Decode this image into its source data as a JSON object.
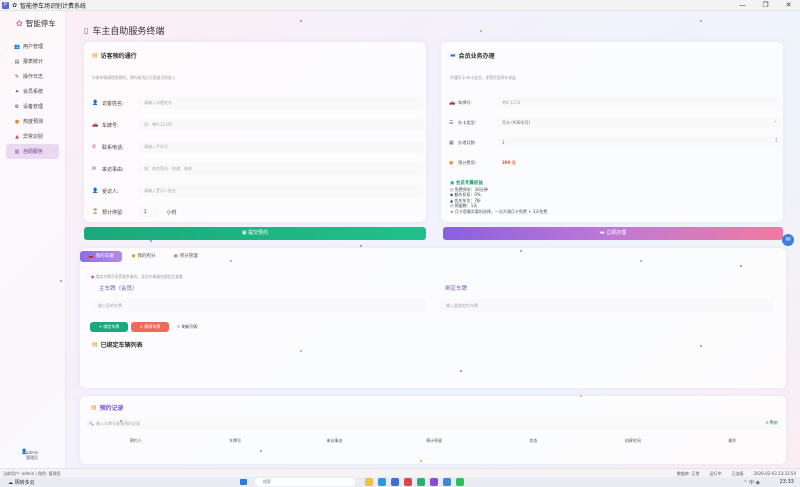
{
  "window": {
    "title": "智能停车场识别计费系统",
    "controls": [
      "—",
      "❐",
      "✕"
    ]
  },
  "sidebar": {
    "brand": "智能停车",
    "items": [
      {
        "label": "用户管理",
        "icon": "users-icon"
      },
      {
        "label": "报表统计",
        "icon": "chart-icon"
      },
      {
        "label": "操作日志",
        "icon": "log-icon"
      },
      {
        "label": "会员系统",
        "icon": "member-icon"
      },
      {
        "label": "设备管理",
        "icon": "device-icon"
      },
      {
        "label": "热度预测",
        "icon": "fire-icon"
      },
      {
        "label": "异常识别",
        "icon": "warning-icon"
      },
      {
        "label": "自助服务",
        "icon": "self-service-icon",
        "active": true
      }
    ],
    "user": {
      "name": "admin",
      "role": "管理员"
    }
  },
  "page": {
    "title": "车主自助服务终端"
  },
  "visitor": {
    "title": "访客预约通行",
    "subtitle": "外来车辆请提前预约，预约成功后可直接识别进入",
    "fields": [
      {
        "label": "访客姓名:",
        "placeholder": "请输入访客姓名"
      },
      {
        "label": "车牌号:",
        "placeholder": "如：粤A·12345"
      },
      {
        "label": "联系电话:",
        "placeholder": "请输入手机号"
      },
      {
        "label": "来访事由:",
        "placeholder": "如：商务拜访、快递、装修"
      },
      {
        "label": "受访人:",
        "placeholder": "请输入受访人姓名"
      }
    ],
    "duration": {
      "label": "预计停留:",
      "value": "2",
      "unit": "小时"
    },
    "submit": "提交预约"
  },
  "member": {
    "title": "会员业务办理",
    "subtitle": "开通月卡/年卡会员，享受优惠停车权益",
    "fields": [
      {
        "label": "车牌号:",
        "placeholder": "粤B·1234"
      },
      {
        "label": "办卡类型:",
        "value": "月卡 (¥300/月)"
      },
      {
        "label": "办理月数:",
        "value": "1"
      },
      {
        "label": "预计费用:",
        "value": "300 元"
      }
    ],
    "benefits_title": "会员专属权益",
    "benefits": [
      "免费停车：30分钟",
      "额外折扣：0%",
      "优先车位：7折",
      "预留数：1天",
      "月卡是最实惠的选择，一次开通月卡免费 + 3天免费"
    ],
    "pay": "立即办理"
  },
  "tabs": [
    {
      "label": "我的车辆",
      "active": true
    },
    {
      "label": "我的积分",
      "active": false
    },
    {
      "label": "积分管理",
      "active": false
    }
  ],
  "binding": {
    "hint": "绑定车牌可享受更多服务，会员车辆请在绑定后查看",
    "primary_label": "主车牌（会员）",
    "primary_placeholder": "输入您的车牌",
    "secondary_label": "绑定车牌",
    "secondary_placeholder": "输入要绑定的车牌",
    "buttons": {
      "bind": "绑定车牌",
      "unbind": "解绑车牌",
      "refresh": "刷新列表"
    },
    "list_title": "已绑定车辆列表"
  },
  "records": {
    "title": "预约记录",
    "search_placeholder": "输入车牌号查询预约记录",
    "refresh": "刷新",
    "columns": [
      "预约人",
      "车牌号",
      "来访事由",
      "预计停留",
      "状态",
      "创建时间",
      "操作"
    ]
  },
  "statusbar": {
    "left": "当前用户: admin | 角色: 管理员",
    "right": [
      "数据库: 正常",
      "运行中",
      "已连接",
      "2026-02-03 23:33:54"
    ]
  },
  "taskbar": {
    "weather": "阴转多云",
    "search": "搜索",
    "clock": "23:33"
  },
  "colors": {
    "accent_green": "#1aa97a",
    "accent_purple": "#8a5fe0",
    "accent_pink": "#f07aa0",
    "active_nav": "#ead9f1"
  }
}
